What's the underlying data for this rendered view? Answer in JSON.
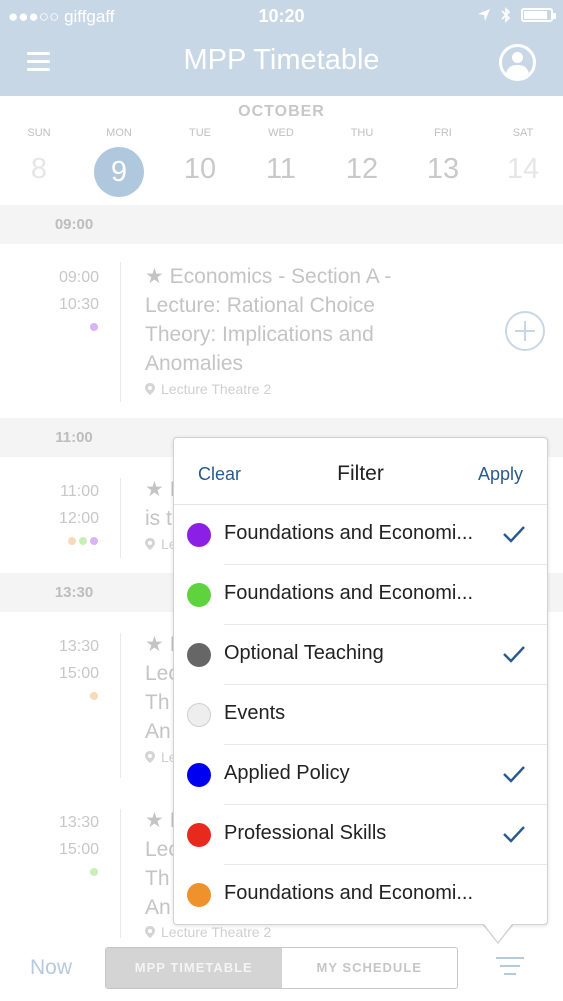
{
  "status_bar": {
    "carrier": "●●●○○ giffgaff",
    "time": "10:20"
  },
  "header": {
    "title": "MPP Timetable"
  },
  "calendar": {
    "month": "OCTOBER",
    "days": [
      {
        "name": "SUN",
        "num": "8"
      },
      {
        "name": "MON",
        "num": "9"
      },
      {
        "name": "TUE",
        "num": "10"
      },
      {
        "name": "WED",
        "num": "11"
      },
      {
        "name": "THU",
        "num": "12"
      },
      {
        "name": "FRI",
        "num": "13"
      },
      {
        "name": "SAT",
        "num": "14"
      }
    ],
    "selected_day": "9"
  },
  "schedule": {
    "bands": [
      "09:00",
      "11:00",
      "13:30"
    ],
    "events": [
      {
        "start": "09:00",
        "end": "10:30",
        "title": "★ Economics - Section A - Lecture: Rational Choice Theory: Implications and Anomalies",
        "location": "Lecture Theatre 2"
      },
      {
        "start": "11:00",
        "end": "12:00",
        "title": "★ I",
        "title2": "is t",
        "location": "Le"
      },
      {
        "start": "13:30",
        "end": "15:00",
        "title": "★ I",
        "title2": "Lec",
        "title3": "Th",
        "title4": "An",
        "location": "Le"
      },
      {
        "start": "13:30",
        "end": "15:00",
        "title": "★ I",
        "title2": "Lec",
        "title3": "Th",
        "title4": "An",
        "location": "Lecture Theatre 2"
      }
    ]
  },
  "filter": {
    "clear_label": "Clear",
    "title": "Filter",
    "apply_label": "Apply",
    "items": [
      {
        "label": "Foundations and Economi...",
        "color": "#8b1fe6",
        "checked": true
      },
      {
        "label": "Foundations and Economi...",
        "color": "#5fd33e",
        "checked": false
      },
      {
        "label": "Optional Teaching",
        "color": "#666666",
        "checked": true
      },
      {
        "label": "Events",
        "color": "#eeeeee",
        "checked": false
      },
      {
        "label": "Applied Policy",
        "color": "#0000f0",
        "checked": true
      },
      {
        "label": "Professional Skills",
        "color": "#e8291e",
        "checked": true
      },
      {
        "label": "Foundations and Economi...",
        "color": "#f0922b",
        "checked": false
      }
    ]
  },
  "bottom_bar": {
    "now_label": "Now",
    "tab_timetable": "MPP TIMETABLE",
    "tab_schedule": "MY SCHEDULE"
  }
}
